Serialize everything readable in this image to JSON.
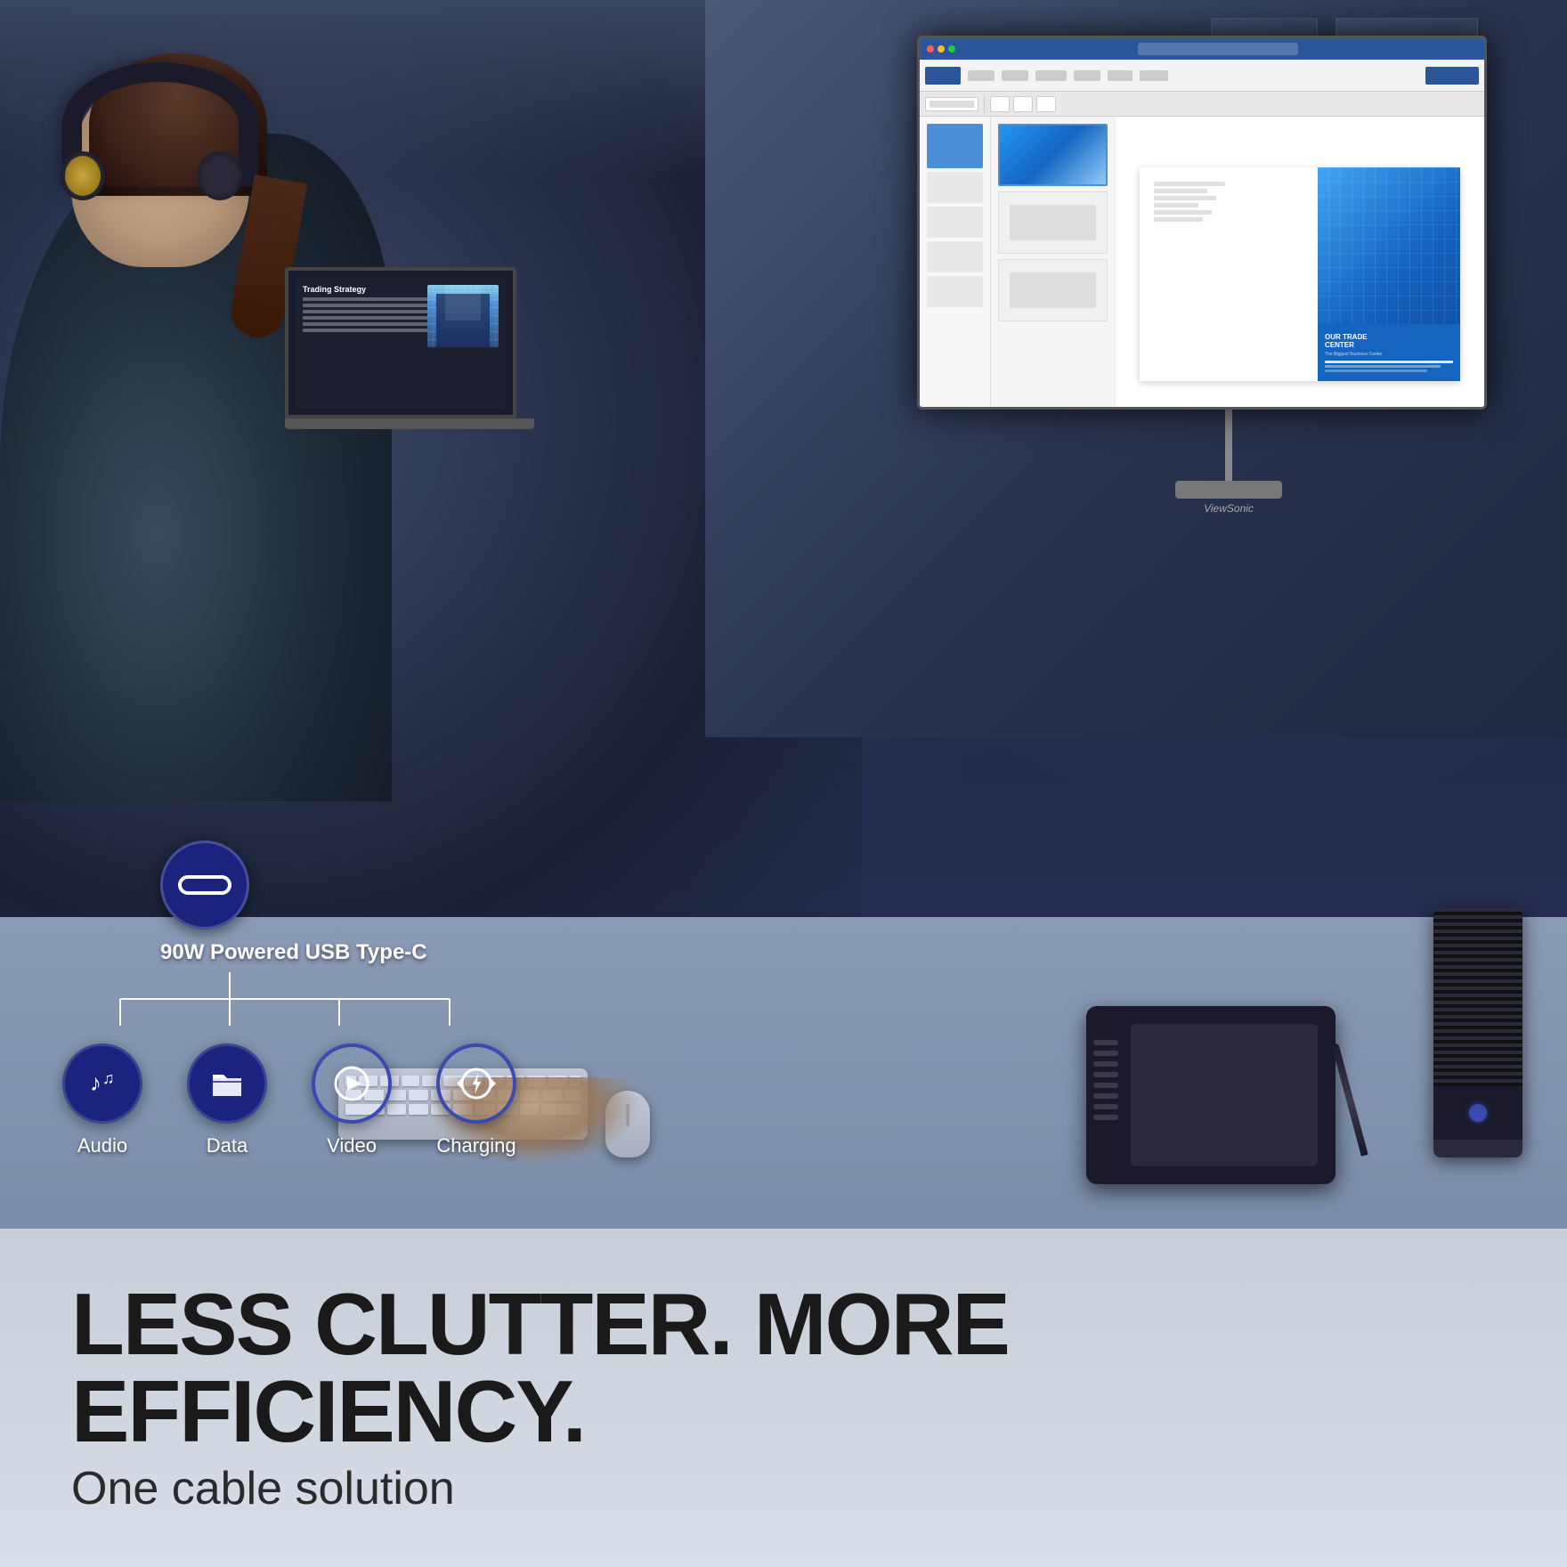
{
  "product": {
    "usbc_label": "90W Powered USB Type-C",
    "features": [
      {
        "id": "audio",
        "label": "Audio",
        "icon": "music-note"
      },
      {
        "id": "data",
        "label": "Data",
        "icon": "folder"
      },
      {
        "id": "video",
        "label": "Video",
        "icon": "play-circle"
      },
      {
        "id": "charging",
        "label": "Charging",
        "icon": "lightning-circle"
      }
    ]
  },
  "bottom": {
    "headline": "LESS CLUTTER. MORE EFFICIENCY.",
    "subheadline": "One cable solution"
  },
  "monitor": {
    "brand": "ViewSonic",
    "slide_title": "OUR TRADE\nCENTER",
    "slide_subtitle": "The Biggest Business Center"
  },
  "laptop": {
    "title": "Trading Strategy"
  },
  "colors": {
    "navy": "#1a237e",
    "dark_bg": "#1a1a2e",
    "white": "#ffffff",
    "light_gray": "#c8ced8",
    "text_dark": "#1a1a1a",
    "blue_accent": "#1565C0"
  }
}
